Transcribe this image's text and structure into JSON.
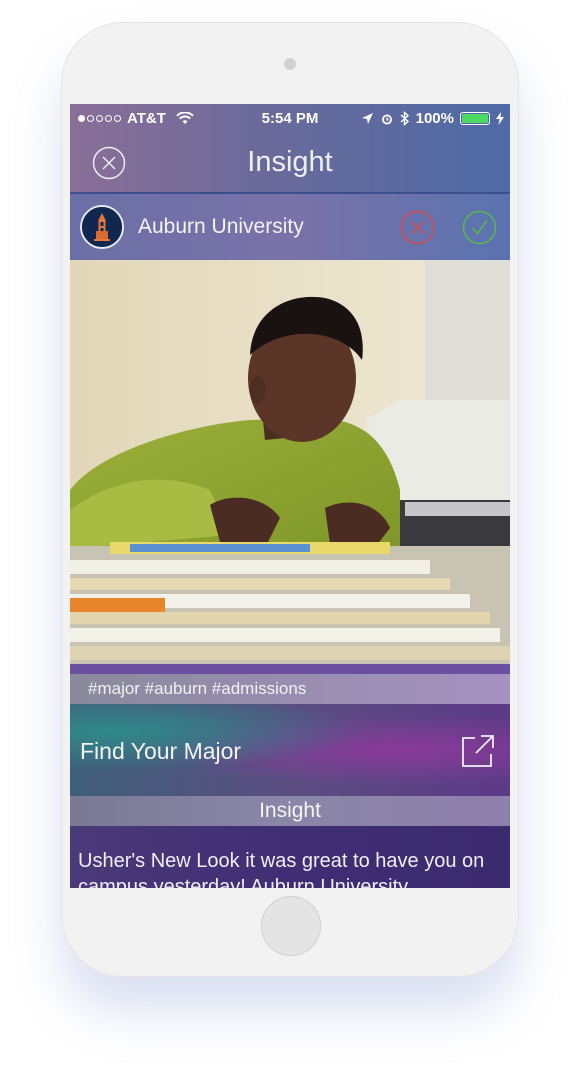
{
  "status_bar": {
    "carrier": "AT&T",
    "time": "5:54 PM",
    "battery": "100%",
    "battery_level": 1.0
  },
  "nav": {
    "title": "Insight",
    "close_icon": "close-circle-icon"
  },
  "card": {
    "organization": "Auburn University",
    "avatar_icon": "tower-logo-icon",
    "reject_icon": "reject-circle-icon",
    "accept_icon": "check-circle-icon",
    "tags": "#major #auburn #admissions",
    "cta_label": "Find Your Major",
    "cta_icon": "external-link-icon",
    "section_title": "Insight",
    "body": "Usher's New Look it was great to have you on campus yesterday! Auburn University"
  },
  "colors": {
    "reject": "#d6494a",
    "accept": "#57b94a",
    "battery": "#4cd964"
  }
}
